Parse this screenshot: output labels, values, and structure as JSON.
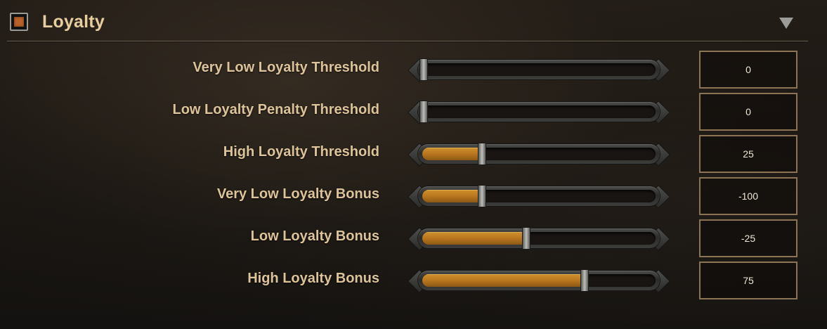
{
  "section": {
    "title": "Loyalty",
    "enabled": true,
    "checkbox_color": "#b8612a",
    "collapse_icon": "triangle-down-icon"
  },
  "colors": {
    "label": "#dcc39a",
    "title": "#e7cda0",
    "slider_fill": "#c5842a",
    "value_border": "#8a7455"
  },
  "settings": [
    {
      "label": "Very Low Loyalty Threshold",
      "value": "0",
      "fill_fraction": 0.0
    },
    {
      "label": "Low Loyalty Penalty Threshold",
      "value": "0",
      "fill_fraction": 0.0
    },
    {
      "label": "High Loyalty Threshold",
      "value": "25",
      "fill_fraction": 0.25
    },
    {
      "label": "Very Low Loyalty Bonus",
      "value": "-100",
      "fill_fraction": 0.25
    },
    {
      "label": "Low Loyalty Bonus",
      "value": "-25",
      "fill_fraction": 0.44
    },
    {
      "label": "High Loyalty Bonus",
      "value": "75",
      "fill_fraction": 0.69
    }
  ]
}
